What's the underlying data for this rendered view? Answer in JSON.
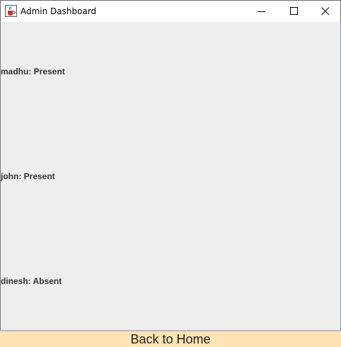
{
  "window": {
    "title": "Admin Dashboard",
    "app_icon": "java-cup-icon",
    "controls": {
      "minimize_icon": "minimize-icon",
      "maximize_icon": "maximize-icon",
      "close_icon": "close-icon"
    }
  },
  "attendance": {
    "records": [
      {
        "text": "madhu: Present"
      },
      {
        "text": "john: Present"
      },
      {
        "text": "dinesh: Absent"
      }
    ]
  },
  "footer": {
    "back_label": "Back to Home",
    "back_color": "#ffe4b5"
  }
}
